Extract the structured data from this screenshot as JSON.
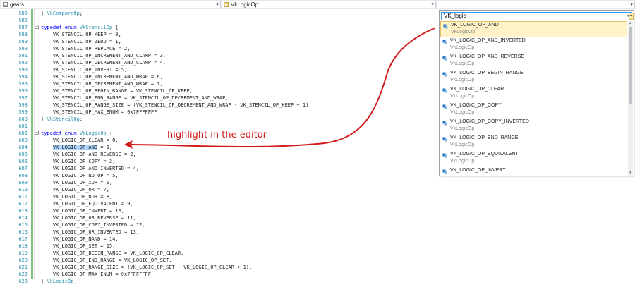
{
  "navbar": {
    "project": "gears",
    "scope": "VkLogicOp",
    "members": ""
  },
  "colors": {
    "annotation": "#d11a1a",
    "keyword": "#0000ff",
    "type": "#2b91af",
    "selection": "#add6ff"
  },
  "editor": {
    "lines": [
      {
        "n": "585",
        "fold": false,
        "parts": [
          [
            "p",
            "} "
          ],
          [
            "t",
            "VkCompareOp"
          ],
          [
            "p",
            ";"
          ]
        ]
      },
      {
        "n": "586",
        "fold": false,
        "parts": []
      },
      {
        "n": "587",
        "fold": true,
        "parts": [
          [
            "k",
            "typedef"
          ],
          [
            "p",
            " "
          ],
          [
            "k",
            "enum"
          ],
          [
            "p",
            " "
          ],
          [
            "t",
            "VkStencilOp"
          ],
          [
            "p",
            " {"
          ]
        ]
      },
      {
        "n": "588",
        "fold": false,
        "parts": [
          [
            "p",
            "    VK_STENCIL_OP_KEEP = 0,"
          ]
        ]
      },
      {
        "n": "589",
        "fold": false,
        "parts": [
          [
            "p",
            "    VK_STENCIL_OP_ZERO = 1,"
          ]
        ]
      },
      {
        "n": "590",
        "fold": false,
        "parts": [
          [
            "p",
            "    VK_STENCIL_OP_REPLACE = 2,"
          ]
        ]
      },
      {
        "n": "591",
        "fold": false,
        "parts": [
          [
            "p",
            "    VK_STENCIL_OP_INCREMENT_AND_CLAMP = 3,"
          ]
        ]
      },
      {
        "n": "592",
        "fold": false,
        "parts": [
          [
            "p",
            "    VK_STENCIL_OP_DECREMENT_AND_CLAMP = 4,"
          ]
        ]
      },
      {
        "n": "593",
        "fold": false,
        "parts": [
          [
            "p",
            "    VK_STENCIL_OP_INVERT = 5,"
          ]
        ]
      },
      {
        "n": "594",
        "fold": false,
        "parts": [
          [
            "p",
            "    VK_STENCIL_OP_INCREMENT_AND_WRAP = 6,"
          ]
        ]
      },
      {
        "n": "595",
        "fold": false,
        "parts": [
          [
            "p",
            "    VK_STENCIL_OP_DECREMENT_AND_WRAP = 7,"
          ]
        ]
      },
      {
        "n": "596",
        "fold": false,
        "parts": [
          [
            "p",
            "    VK_STENCIL_OP_BEGIN_RANGE = VK_STENCIL_OP_KEEP,"
          ]
        ]
      },
      {
        "n": "597",
        "fold": false,
        "parts": [
          [
            "p",
            "    VK_STENCIL_OP_END_RANGE = VK_STENCIL_OP_DECREMENT_AND_WRAP,"
          ]
        ]
      },
      {
        "n": "598",
        "fold": false,
        "parts": [
          [
            "p",
            "    VK_STENCIL_OP_RANGE_SIZE = (VK_STENCIL_OP_DECREMENT_AND_WRAP - VK_STENCIL_OP_KEEP + 1),"
          ]
        ]
      },
      {
        "n": "599",
        "fold": false,
        "parts": [
          [
            "p",
            "    VK_STENCIL_OP_MAX_ENUM = 0x7FFFFFFF"
          ]
        ]
      },
      {
        "n": "600",
        "fold": false,
        "parts": [
          [
            "p",
            "} "
          ],
          [
            "t",
            "VkStencilOp"
          ],
          [
            "p",
            ";"
          ]
        ]
      },
      {
        "n": "601",
        "fold": false,
        "parts": []
      },
      {
        "n": "602",
        "fold": true,
        "parts": [
          [
            "k",
            "typedef"
          ],
          [
            "p",
            " "
          ],
          [
            "k",
            "enum"
          ],
          [
            "p",
            " "
          ],
          [
            "t",
            "VkLogicOp"
          ],
          [
            "p",
            " {"
          ]
        ]
      },
      {
        "n": "603",
        "fold": false,
        "parts": [
          [
            "p",
            "    VK_LOGIC_OP_CLEAR = 0,"
          ]
        ]
      },
      {
        "n": "604",
        "fold": false,
        "parts": [
          [
            "p",
            "    "
          ],
          [
            "h",
            "VK_LOGIC_OP_AND"
          ],
          [
            "p",
            " = 1,"
          ]
        ]
      },
      {
        "n": "605",
        "fold": false,
        "parts": [
          [
            "p",
            "    VK_LOGIC_OP_AND_REVERSE = 2,"
          ]
        ]
      },
      {
        "n": "606",
        "fold": false,
        "parts": [
          [
            "p",
            "    VK_LOGIC_OP_COPY = 3,"
          ]
        ]
      },
      {
        "n": "607",
        "fold": false,
        "parts": [
          [
            "p",
            "    VK_LOGIC_OP_AND_INVERTED = 4,"
          ]
        ]
      },
      {
        "n": "608",
        "fold": false,
        "parts": [
          [
            "p",
            "    VK_LOGIC_OP_NO_OP = 5,"
          ]
        ]
      },
      {
        "n": "609",
        "fold": false,
        "parts": [
          [
            "p",
            "    VK_LOGIC_OP_XOR = 6,"
          ]
        ]
      },
      {
        "n": "610",
        "fold": false,
        "parts": [
          [
            "p",
            "    VK_LOGIC_OP_OR = 7,"
          ]
        ]
      },
      {
        "n": "611",
        "fold": false,
        "parts": [
          [
            "p",
            "    VK_LOGIC_OP_NOR = 8,"
          ]
        ]
      },
      {
        "n": "612",
        "fold": false,
        "parts": [
          [
            "p",
            "    VK_LOGIC_OP_EQUIVALENT = 9,"
          ]
        ]
      },
      {
        "n": "613",
        "fold": false,
        "parts": [
          [
            "p",
            "    VK_LOGIC_OP_INVERT = 10,"
          ]
        ]
      },
      {
        "n": "614",
        "fold": false,
        "parts": [
          [
            "p",
            "    VK_LOGIC_OP_OR_REVERSE = 11,"
          ]
        ]
      },
      {
        "n": "615",
        "fold": false,
        "parts": [
          [
            "p",
            "    VK_LOGIC_OP_COPY_INVERTED = 12,"
          ]
        ]
      },
      {
        "n": "616",
        "fold": false,
        "parts": [
          [
            "p",
            "    VK_LOGIC_OP_OR_INVERTED = 13,"
          ]
        ]
      },
      {
        "n": "617",
        "fold": false,
        "parts": [
          [
            "p",
            "    VK_LOGIC_OP_NAND = 14,"
          ]
        ]
      },
      {
        "n": "618",
        "fold": false,
        "parts": [
          [
            "p",
            "    VK_LOGIC_OP_SET = 15,"
          ]
        ]
      },
      {
        "n": "619",
        "fold": false,
        "parts": [
          [
            "p",
            "    VK_LOGIC_OP_BEGIN_RANGE = VK_LOGIC_OP_CLEAR,"
          ]
        ]
      },
      {
        "n": "620",
        "fold": false,
        "parts": [
          [
            "p",
            "    VK_LOGIC_OP_END_RANGE = VK_LOGIC_OP_SET,"
          ]
        ]
      },
      {
        "n": "621",
        "fold": false,
        "parts": [
          [
            "p",
            "    VK_LOGIC_OP_RANGE_SIZE = (VK_LOGIC_OP_SET - VK_LOGIC_OP_CLEAR + 1),"
          ]
        ]
      },
      {
        "n": "622",
        "fold": false,
        "parts": [
          [
            "p",
            "    VK_LOGIC_OP_MAX_ENUM = 0x7FFFFFFF"
          ]
        ]
      },
      {
        "n": "623",
        "fold": false,
        "parts": [
          [
            "p",
            "} "
          ],
          [
            "t",
            "VkLogicOp"
          ],
          [
            "p",
            ";"
          ]
        ]
      }
    ]
  },
  "annotation": {
    "text": "highlight in the editor"
  },
  "popup": {
    "search_value": "VK_logic",
    "clear_glyph": "×",
    "dropdown_glyph": "▾",
    "items": [
      {
        "name": "VK_LOGIC_OP_AND",
        "sub": "VkLogicOp",
        "selected": true
      },
      {
        "name": "VK_LOGIC_OP_AND_INVERTED",
        "sub": "VkLogicOp",
        "selected": false
      },
      {
        "name": "VK_LOGIC_OP_AND_REVERSE",
        "sub": "VkLogicOp",
        "selected": false
      },
      {
        "name": "VK_LOGIC_OP_BEGIN_RANGE",
        "sub": "VkLogicOp",
        "selected": false
      },
      {
        "name": "VK_LOGIC_OP_CLEAR",
        "sub": "VkLogicOp",
        "selected": false
      },
      {
        "name": "VK_LOGIC_OP_COPY",
        "sub": "VkLogicOp",
        "selected": false
      },
      {
        "name": "VK_LOGIC_OP_COPY_INVERTED",
        "sub": "VkLogicOp",
        "selected": false
      },
      {
        "name": "VK_LOGIC_OP_END_RANGE",
        "sub": "VkLogicOp",
        "selected": false
      },
      {
        "name": "VK_LOGIC_OP_EQUIVALENT",
        "sub": "VkLogicOp",
        "selected": false
      },
      {
        "name": "VK_LOGIC_OP_INVERT",
        "sub": "",
        "selected": false
      }
    ]
  }
}
